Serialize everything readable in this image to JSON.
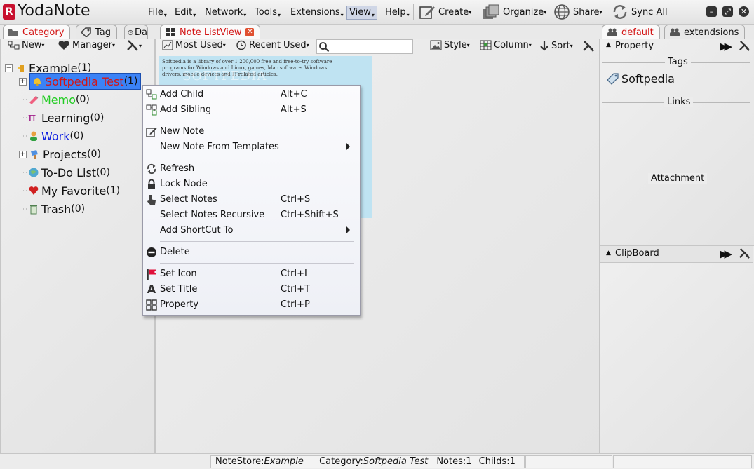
{
  "app": {
    "logo": "R",
    "title": "YodaNote"
  },
  "menu": [
    "File",
    "Edit",
    "Network",
    "Tools",
    "Extensions",
    "View",
    "Help"
  ],
  "toolbar": {
    "create": "Create",
    "organize": "Organize",
    "share": "Share",
    "sync": "Sync All"
  },
  "left_tabs": {
    "category": "Category",
    "tag": "Tag",
    "partial": "Da"
  },
  "left_toolbar": {
    "new": "New",
    "manager": "Manager"
  },
  "tree": {
    "root": {
      "label": "Example",
      "count": "(1)"
    },
    "nodes": [
      {
        "label": "Softpedia Test",
        "count": "(1)",
        "color": "#d31515"
      },
      {
        "label": "Memo",
        "count": "(0)",
        "color": "#22cc22"
      },
      {
        "label": "Learning",
        "count": "(0)",
        "color": "#111111"
      },
      {
        "label": "Work",
        "count": "(0)",
        "color": "#1020e0"
      },
      {
        "label": "Projects",
        "count": "(0)",
        "color": "#111111"
      },
      {
        "label": "To-Do List",
        "count": "(0)",
        "color": "#111111"
      },
      {
        "label": "My Favorite",
        "count": "(1)",
        "color": "#111111"
      },
      {
        "label": "Trash",
        "count": "(0)",
        "color": "#111111"
      }
    ]
  },
  "center_tab": {
    "label": "Note ListView"
  },
  "center_toolbar": {
    "most_used": "Most Used",
    "recent_used": "Recent Used",
    "search_placeholder": "",
    "style": "Style",
    "column": "Column",
    "sort": "Sort"
  },
  "note_thumb": {
    "text": "Softpedia is a library of over 1 200,000 free and free-to-try software programs for Windows and Linux, games, Mac software, Windows drivers, mobile devices and IT-related articles.",
    "watermark": "SOFTPEDIA"
  },
  "context_menu": {
    "items": [
      {
        "label": "Add Child",
        "shortcut": "Alt+C",
        "icon": "add-child-icon"
      },
      {
        "label": "Add Sibling",
        "shortcut": "Alt+S",
        "icon": "add-sibling-icon"
      },
      {
        "label": "New Note",
        "shortcut": "",
        "icon": "new-note-icon"
      },
      {
        "label": "New Note From Templates",
        "shortcut": "",
        "icon": "",
        "submenu": true
      },
      {
        "label": "Refresh",
        "shortcut": "",
        "icon": "refresh-icon"
      },
      {
        "label": "Lock Node",
        "shortcut": "",
        "icon": "lock-icon"
      },
      {
        "label": "Select Notes",
        "shortcut": "Ctrl+S",
        "icon": "pointer-icon"
      },
      {
        "label": "Select Notes Recursive",
        "shortcut": "Ctrl+Shift+S",
        "icon": ""
      },
      {
        "label": "Add ShortCut To",
        "shortcut": "",
        "icon": "",
        "submenu": true
      },
      {
        "label": "Delete",
        "shortcut": "",
        "icon": "delete-icon"
      },
      {
        "label": "Set Icon",
        "shortcut": "Ctrl+I",
        "icon": "flag-icon"
      },
      {
        "label": "Set Title",
        "shortcut": "Ctrl+T",
        "icon": "title-icon"
      },
      {
        "label": "Property",
        "shortcut": "Ctrl+P",
        "icon": "property-icon"
      }
    ]
  },
  "right_tabs": {
    "default": "default",
    "extensions": "extendsions"
  },
  "property_panel": {
    "title": "Property",
    "tags_label": "Tags",
    "tag_value": "Softpedia",
    "links_label": "Links",
    "attachment_label": "Attachment"
  },
  "clipboard_panel": {
    "title": "ClipBoard"
  },
  "status": {
    "notestore_label": "NoteStore:",
    "notestore_value": "Example",
    "category_label": "Category:",
    "category_value": "Softpedia Test",
    "notes": "Notes:1",
    "childs": "Childs:1"
  },
  "colors": {
    "accent_red": "#d31515",
    "selection_blue": "#3b82f6",
    "note_thumb": "#bfe3f2"
  }
}
